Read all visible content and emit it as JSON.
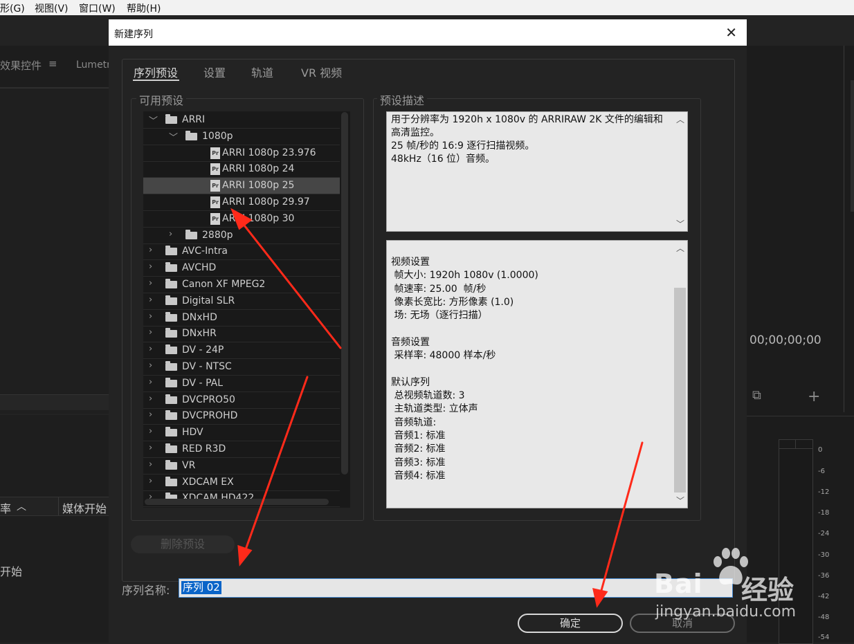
{
  "menubar": {
    "items": [
      "形(G)",
      "视图(V)",
      "窗口(W)",
      "帮助(H)"
    ]
  },
  "background": {
    "effects_tab": "效果控件",
    "lumetri_tab": "Lumetri",
    "column_rate": "率",
    "column_media_start": "媒体开始",
    "row_text": "开始",
    "timecode": "00;00;00;00",
    "meter_scale": [
      "0",
      "-6",
      "-12",
      "-18",
      "-24",
      "-30",
      "-36",
      "-42",
      "-48",
      "-54"
    ]
  },
  "dialog": {
    "title": "新建序列",
    "tabs": [
      "序列预设",
      "设置",
      "轨道",
      "VR 视频"
    ],
    "available_presets_label": "可用预设",
    "preset_description_label": "预设描述",
    "presets": [
      {
        "label": "ARRI",
        "type": "folder",
        "level": 0,
        "expanded": true
      },
      {
        "label": "1080p",
        "type": "folder",
        "level": 1,
        "expanded": true
      },
      {
        "label": "ARRI 1080p 23.976",
        "type": "file",
        "level": 2
      },
      {
        "label": "ARRI 1080p 24",
        "type": "file",
        "level": 2
      },
      {
        "label": "ARRI 1080p 25",
        "type": "file",
        "level": 2,
        "selected": true
      },
      {
        "label": "ARRI 1080p 29.97",
        "type": "file",
        "level": 2
      },
      {
        "label": "ARRI 1080p 30",
        "type": "file",
        "level": 2
      },
      {
        "label": "2880p",
        "type": "folder",
        "level": 1,
        "expanded": false
      },
      {
        "label": "AVC-Intra",
        "type": "folder",
        "level": 0,
        "expanded": false
      },
      {
        "label": "AVCHD",
        "type": "folder",
        "level": 0,
        "expanded": false
      },
      {
        "label": "Canon XF MPEG2",
        "type": "folder",
        "level": 0,
        "expanded": false
      },
      {
        "label": "Digital SLR",
        "type": "folder",
        "level": 0,
        "expanded": false
      },
      {
        "label": "DNxHD",
        "type": "folder",
        "level": 0,
        "expanded": false
      },
      {
        "label": "DNxHR",
        "type": "folder",
        "level": 0,
        "expanded": false
      },
      {
        "label": "DV - 24P",
        "type": "folder",
        "level": 0,
        "expanded": false
      },
      {
        "label": "DV - NTSC",
        "type": "folder",
        "level": 0,
        "expanded": false
      },
      {
        "label": "DV - PAL",
        "type": "folder",
        "level": 0,
        "expanded": false
      },
      {
        "label": "DVCPRO50",
        "type": "folder",
        "level": 0,
        "expanded": false
      },
      {
        "label": "DVCPROHD",
        "type": "folder",
        "level": 0,
        "expanded": false
      },
      {
        "label": "HDV",
        "type": "folder",
        "level": 0,
        "expanded": false
      },
      {
        "label": "RED R3D",
        "type": "folder",
        "level": 0,
        "expanded": false
      },
      {
        "label": "VR",
        "type": "folder",
        "level": 0,
        "expanded": false
      },
      {
        "label": "XDCAM EX",
        "type": "folder",
        "level": 0,
        "expanded": false
      },
      {
        "label": "XDCAM HD422",
        "type": "folder",
        "level": 0,
        "expanded": false
      }
    ],
    "description_lines": [
      "用于分辨率为 1920h x 1080v 的 ARRIRAW 2K 文件的编辑和",
      "高清监控。",
      "25 帧/秒的 16:9 逐行扫描视频。",
      "48kHz（16 位）音频。"
    ],
    "info_lines": [
      "视频设置",
      " 帧大小: 1920h 1080v (1.0000)",
      " 帧速率: 25.00  帧/秒",
      " 像素长宽比: 方形像素 (1.0)",
      " 场: 无场（逐行扫描）",
      "",
      "音频设置",
      " 采样率: 48000 样本/秒",
      "",
      "默认序列",
      " 总视频轨道数: 3",
      " 主轨道类型: 立体声",
      " 音频轨道:",
      " 音频1: 标准",
      " 音频2: 标准",
      " 音频3: 标准",
      " 音频4: 标准"
    ],
    "delete_preset_button": "删除预设",
    "sequence_name_label": "序列名称:",
    "sequence_name_value": "序列 02",
    "ok_button": "确定",
    "cancel_button": "取消"
  },
  "watermark": {
    "brand_left": "Bai",
    "brand_right": "经验",
    "url": "jingyan.baidu.com"
  },
  "annotation_color": "#ff2a1a"
}
